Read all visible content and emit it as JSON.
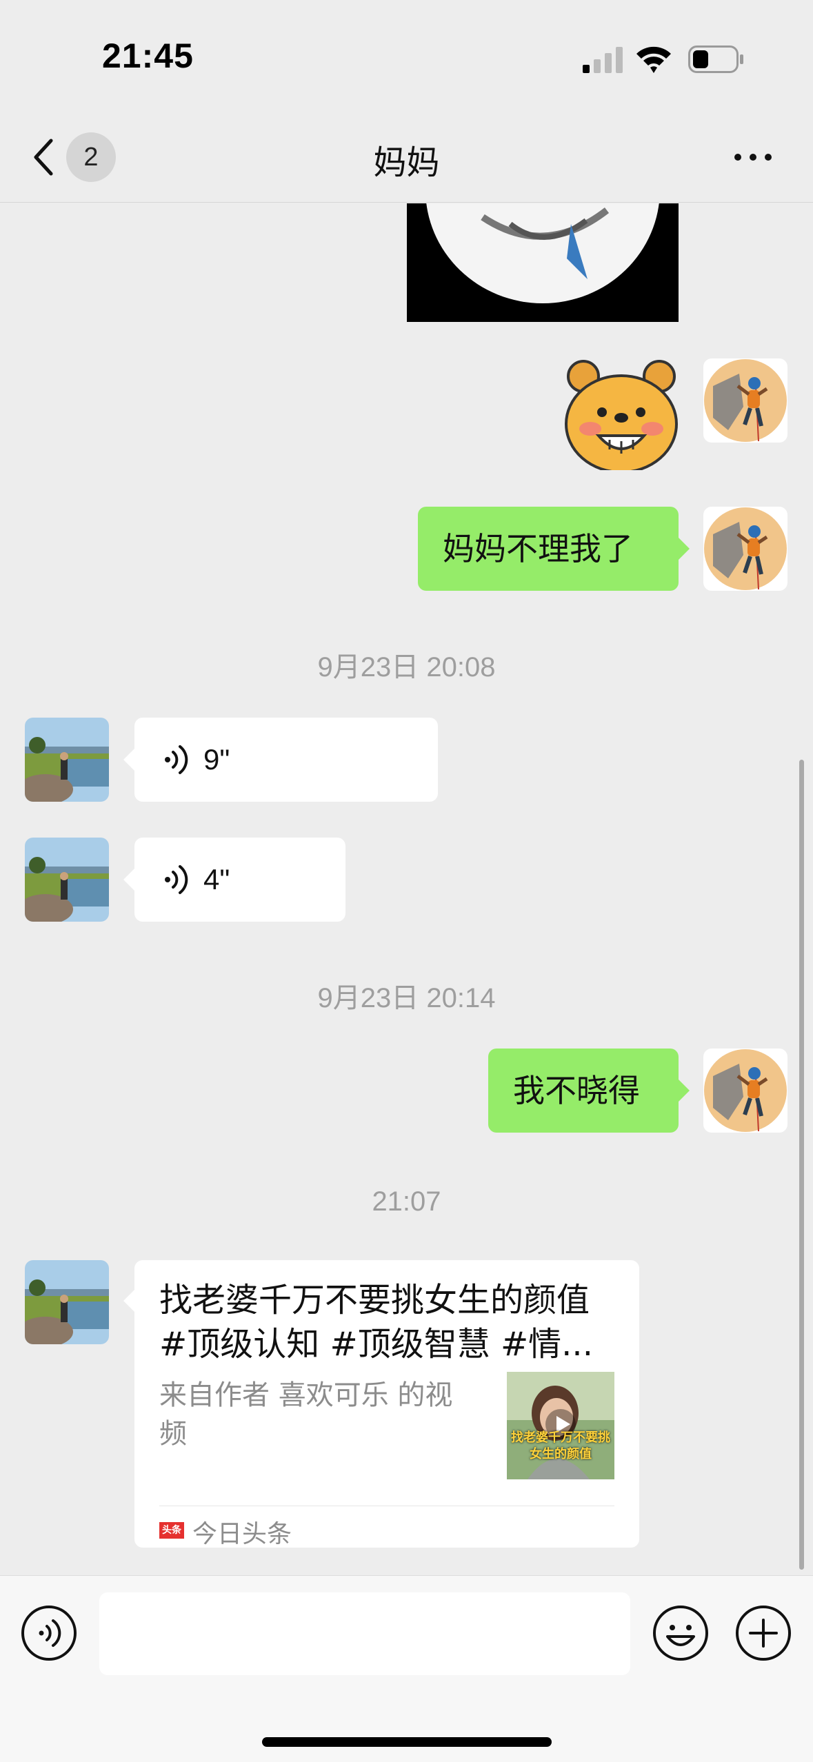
{
  "status_bar": {
    "time": "21:45"
  },
  "nav": {
    "unread_count": "2",
    "title": "妈妈"
  },
  "messages": {
    "m1_text": "妈妈不理我了",
    "ts1": "9月23日 20:08",
    "voice1_duration": "9\"",
    "voice2_duration": "4\"",
    "ts2": "9月23日 20:14",
    "m2_text": "我不晓得",
    "ts3": "21:07"
  },
  "share_card": {
    "title": "找老婆千万不要挑女生的颜值 #顶级认知 #顶级智慧 #情...",
    "description": "来自作者 喜欢可乐 的视频",
    "thumb_caption": "找老婆千万不要挑女生的颜值",
    "source_logo": "头条",
    "source_name": "今日头条"
  },
  "colors": {
    "sent_bubble": "#95ec69",
    "received_bubble": "#ffffff",
    "background": "#ededed"
  }
}
